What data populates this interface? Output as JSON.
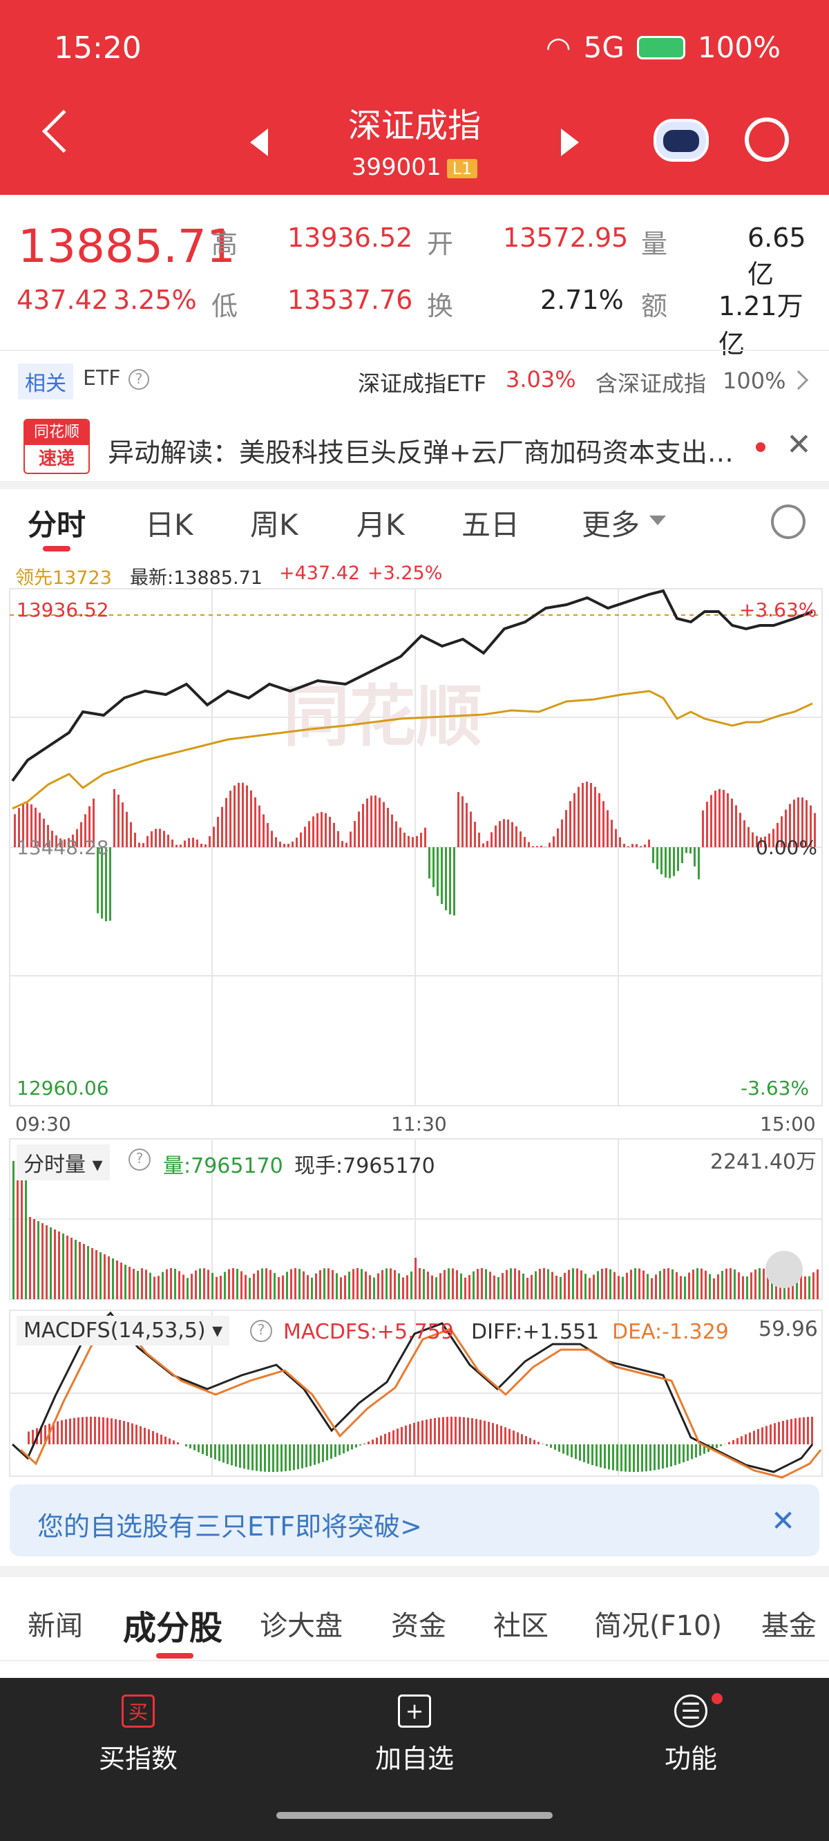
{
  "status": {
    "time": "15:20",
    "battery": "100%",
    "network": "5G"
  },
  "header": {
    "title": "深证成指",
    "code": "399001",
    "level": "L1"
  },
  "quote": {
    "price": "13885.71",
    "change": "437.42",
    "change_pct": "3.25%",
    "high_label": "高",
    "high": "13936.52",
    "low_label": "低",
    "low": "13537.76",
    "open_label": "开",
    "open": "13572.95",
    "turnover_label": "换",
    "turnover": "2.71%",
    "volume_label": "量",
    "volume": "6.65亿",
    "amount_label": "额",
    "amount": "1.21万亿"
  },
  "etf": {
    "tag": "相关",
    "name": "ETF",
    "etf_name": "深证成指ETF",
    "etf_pct": "3.03%",
    "contain": "含深证成指",
    "contain_pct": "100%"
  },
  "news": {
    "logo_top": "同花顺",
    "logo_bottom": "速递",
    "text": "异动解读：美股科技巨头反弹+云厂商加码资本支出…"
  },
  "tabs": [
    "分时",
    "日K",
    "周K",
    "月K",
    "五日",
    "更多"
  ],
  "intraday": {
    "lead": "领先13723",
    "latest": "最新:13885.71",
    "chg": "+437.42",
    "pct": "+3.25%",
    "top": "13936.52",
    "top_pct": "+3.63%",
    "mid": "13448.28",
    "mid_pct": "0.00%",
    "bottom": "12960.06",
    "bottom_pct": "-3.63%",
    "t0": "09:30",
    "t1": "11:30",
    "t2": "15:00",
    "watermark": "同花顺"
  },
  "volume_panel": {
    "label": "分时量",
    "qty": "量:7965170",
    "hand": "现手:7965170",
    "max": "2241.40万"
  },
  "macd_panel": {
    "label": "MACDFS(14,53,5)",
    "macdfs": "MACDFS:+5.759",
    "diff": "DIFF:+1.551",
    "dea": "DEA:-1.329",
    "max": "59.96"
  },
  "notice": {
    "text": "您的自选股有三只ETF即将突破>"
  },
  "bottom_tabs": [
    "新闻",
    "成分股",
    "诊大盘",
    "资金",
    "社区",
    "简况(F10)",
    "基金"
  ],
  "bottombar": {
    "buy": "买指数",
    "add": "加自选",
    "func": "功能",
    "buy_icon": "买",
    "add_icon": "+",
    "func_icon": "☰"
  }
}
